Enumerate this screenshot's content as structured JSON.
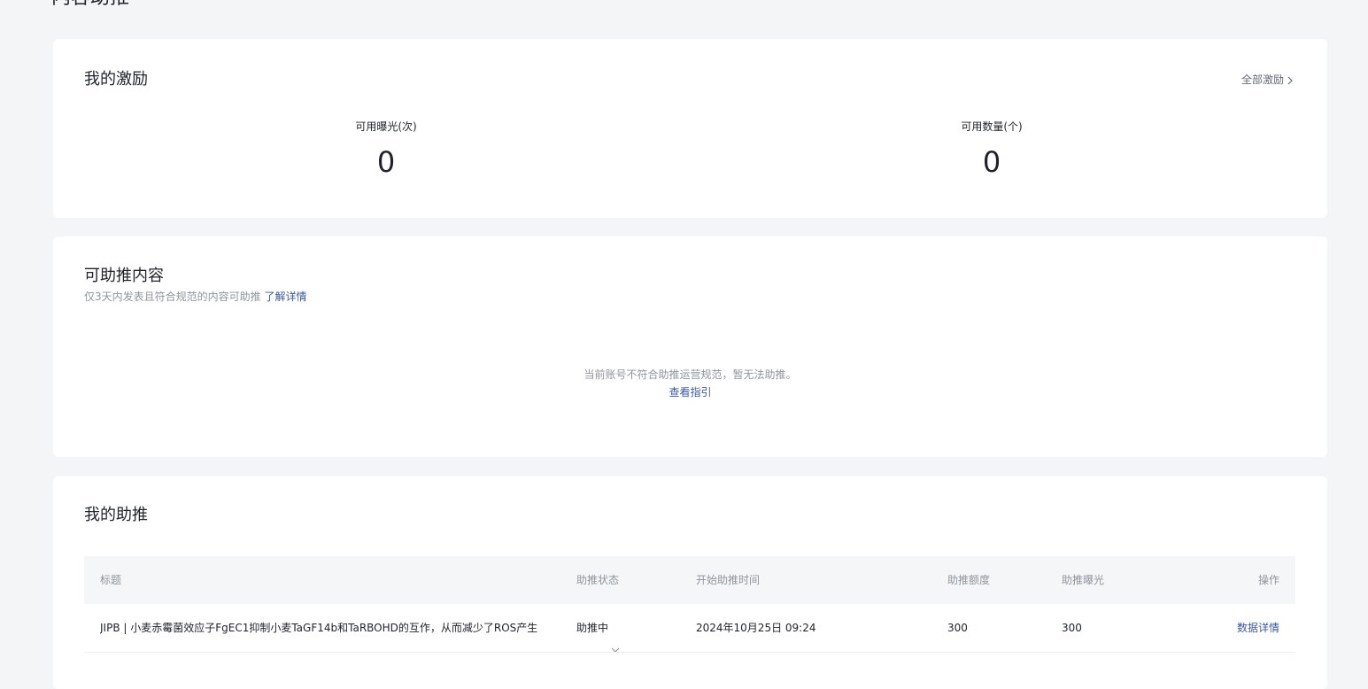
{
  "page": {
    "title": "内容助推"
  },
  "incentive": {
    "heading": "我的激励",
    "all_link": "全部激励",
    "exposure_label": "可用曝光(次)",
    "exposure_value": "0",
    "count_label": "可用数量(个)",
    "count_value": "0"
  },
  "boostable": {
    "heading": "可助推内容",
    "subtitle": "仅3天内发表且符合规范的内容可助推",
    "learn_more": "了解详情",
    "empty_message": "当前账号不符合助推运营规范，暂无法助推。",
    "guide_link": "查看指引"
  },
  "my_boost": {
    "heading": "我的助推",
    "columns": {
      "title": "标题",
      "status": "助推状态",
      "start_time": "开始助推时间",
      "amount": "助推额度",
      "exposure": "助推曝光",
      "action": "操作"
    },
    "rows": [
      {
        "title": "JIPB | 小麦赤霉菌效应子FgEC1抑制小麦TaGF14b和TaRBOHD的互作，从而减少了ROS产生",
        "status": "助推中",
        "start_time": "2024年10月25日 09:24",
        "amount": "300",
        "exposure": "300",
        "action": "数据详情"
      }
    ]
  },
  "colors": {
    "background": "#f4f5f7",
    "card": "#ffffff",
    "link": "#3a5a9c",
    "muted_text": "#8f959e",
    "header_bg": "#f5f6f7"
  }
}
